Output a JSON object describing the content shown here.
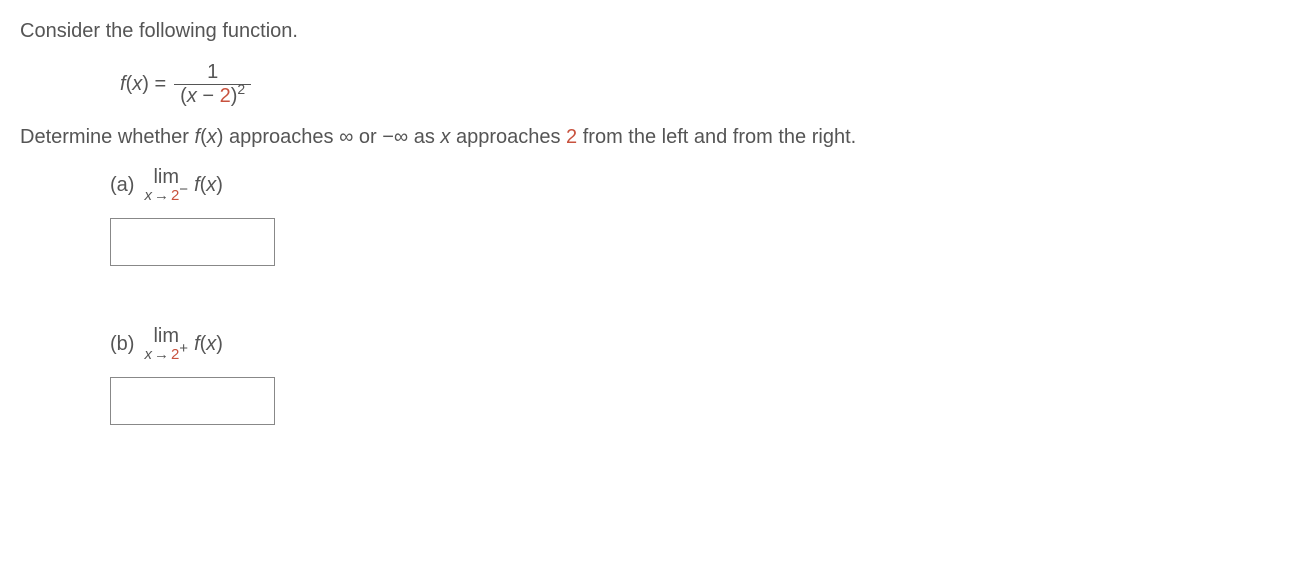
{
  "intro": "Consider the following function.",
  "function": {
    "lhs_f": "f",
    "lhs_open": "(",
    "lhs_x": "x",
    "lhs_close": ") =",
    "numerator": "1",
    "den_open": "(",
    "den_x": "x",
    "den_minus": " − ",
    "den_value": "2",
    "den_close": ")",
    "den_exp": "2"
  },
  "question": {
    "p1": "Determine whether ",
    "fx_f": "f",
    "fx_open": "(",
    "fx_x": "x",
    "fx_close": ")",
    "p2": " approaches ∞ or −∞ as ",
    "x": "x",
    "p3": " approaches ",
    "value": "2",
    "p4": " from the left and from the right."
  },
  "partA": {
    "label": "(a)",
    "lim": "lim",
    "x": "x",
    "arrow": "→",
    "value": "2",
    "sign": "−",
    "fx_f": "f",
    "fx_open": "(",
    "fx_x": "x",
    "fx_close": ")"
  },
  "partB": {
    "label": "(b)",
    "lim": "lim",
    "x": "x",
    "arrow": "→",
    "value": "2",
    "sign": "+",
    "fx_f": "f",
    "fx_open": "(",
    "fx_x": "x",
    "fx_close": ")"
  }
}
